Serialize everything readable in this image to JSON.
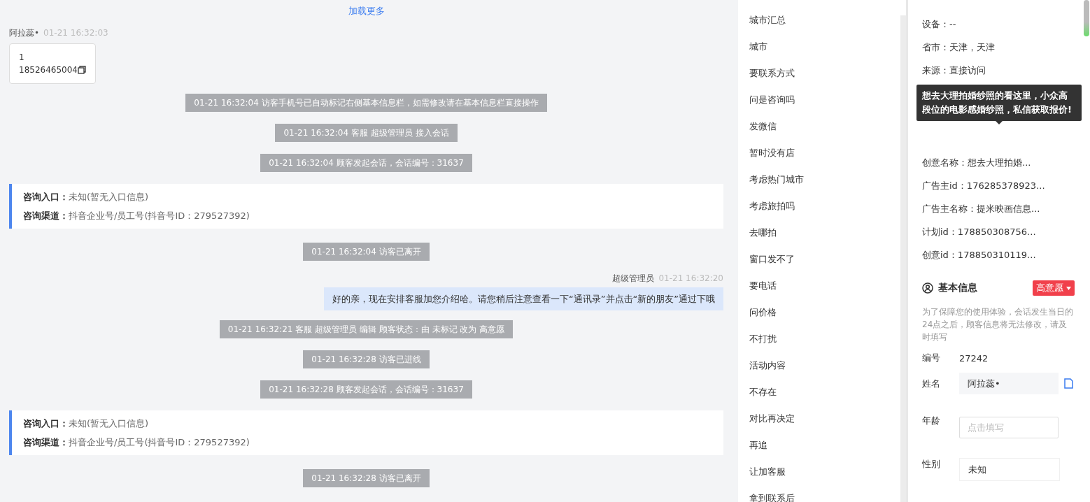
{
  "load_more": "加载更多",
  "messages": [
    {
      "kind": "visitor",
      "sender": "阿拉蕊•",
      "time": "01-21 16:32:03",
      "lines": [
        "1",
        "18526465004"
      ]
    },
    {
      "kind": "system",
      "text": "01-21 16:32:04 访客手机号已自动标记右侧基本信息栏，如需修改请在基本信息栏直接操作"
    },
    {
      "kind": "system",
      "text": "01-21 16:32:04 客服 超级管理员 接入会话"
    },
    {
      "kind": "system",
      "text": "01-21 16:32:04 顾客发起会话，会话编号：31637"
    },
    {
      "kind": "info",
      "rows": [
        {
          "label": "咨询入口：",
          "value": "未知(暂无入口信息)"
        },
        {
          "label": "咨询渠道：",
          "value": "抖音企业号/员工号(抖音号ID：279527392)"
        }
      ]
    },
    {
      "kind": "system",
      "text": "01-21 16:32:04 访客已离开"
    },
    {
      "kind": "agent",
      "sender": "超级管理员",
      "time": "01-21 16:32:20",
      "text": "好的亲，现在安排客服加您介绍哈。请您稍后注意查看一下“通讯录”并点击“新的朋友”通过下哦"
    },
    {
      "kind": "system",
      "text": "01-21 16:32:21 客服 超级管理员 编辑 顾客状态：由 未标记 改为 高意愿"
    },
    {
      "kind": "system",
      "text": "01-21 16:32:28 访客已进线"
    },
    {
      "kind": "system",
      "text": "01-21 16:32:28 顾客发起会话，会话编号：31637"
    },
    {
      "kind": "info",
      "rows": [
        {
          "label": "咨询入口：",
          "value": "未知(暂无入口信息)"
        },
        {
          "label": "咨询渠道：",
          "value": "抖音企业号/员工号(抖音号ID：279527392)"
        }
      ]
    },
    {
      "kind": "system",
      "text": "01-21 16:32:28 访客已离开"
    }
  ],
  "quick_replies": [
    "城市汇总",
    "城市",
    "要联系方式",
    "问是咨询吗",
    "发微信",
    "暂时没有店",
    "考虑热门城市",
    "考虑旅拍吗",
    "去哪拍",
    "窗口发不了",
    "要电话",
    "问价格",
    "不打扰",
    "活动内容",
    "不存在",
    "对比再决定",
    "再追",
    "让加客服",
    "拿到联系后"
  ],
  "source_info": {
    "top": [
      "设备：--",
      "省市：天津，天津",
      "来源：直接访问"
    ],
    "bottom": [
      "创意名称：想去大理拍婚...",
      "广告主id：176285378923...",
      "广告主名称：提米映画信息...",
      "计划id：178850308756...",
      "创意id：178850310119..."
    ]
  },
  "tooltip": "想去大理拍婚纱照的看这里，小众高段位的电影感婚纱照，私信获取报价!",
  "basic_info": {
    "title": "基本信息",
    "status": "高意愿",
    "notice": "为了保障您的使用体验，会话发生当日的24点之后，顾客信息将无法修改，请及时填写",
    "fields": [
      {
        "kind": "text",
        "label": "编号",
        "value": "27242"
      },
      {
        "kind": "filled",
        "label": "姓名",
        "value": "阿拉蕊•"
      },
      {
        "kind": "input",
        "label": "年龄",
        "placeholder": "点击填写"
      },
      {
        "kind": "select",
        "label": "性别",
        "value": "未知"
      }
    ]
  }
}
